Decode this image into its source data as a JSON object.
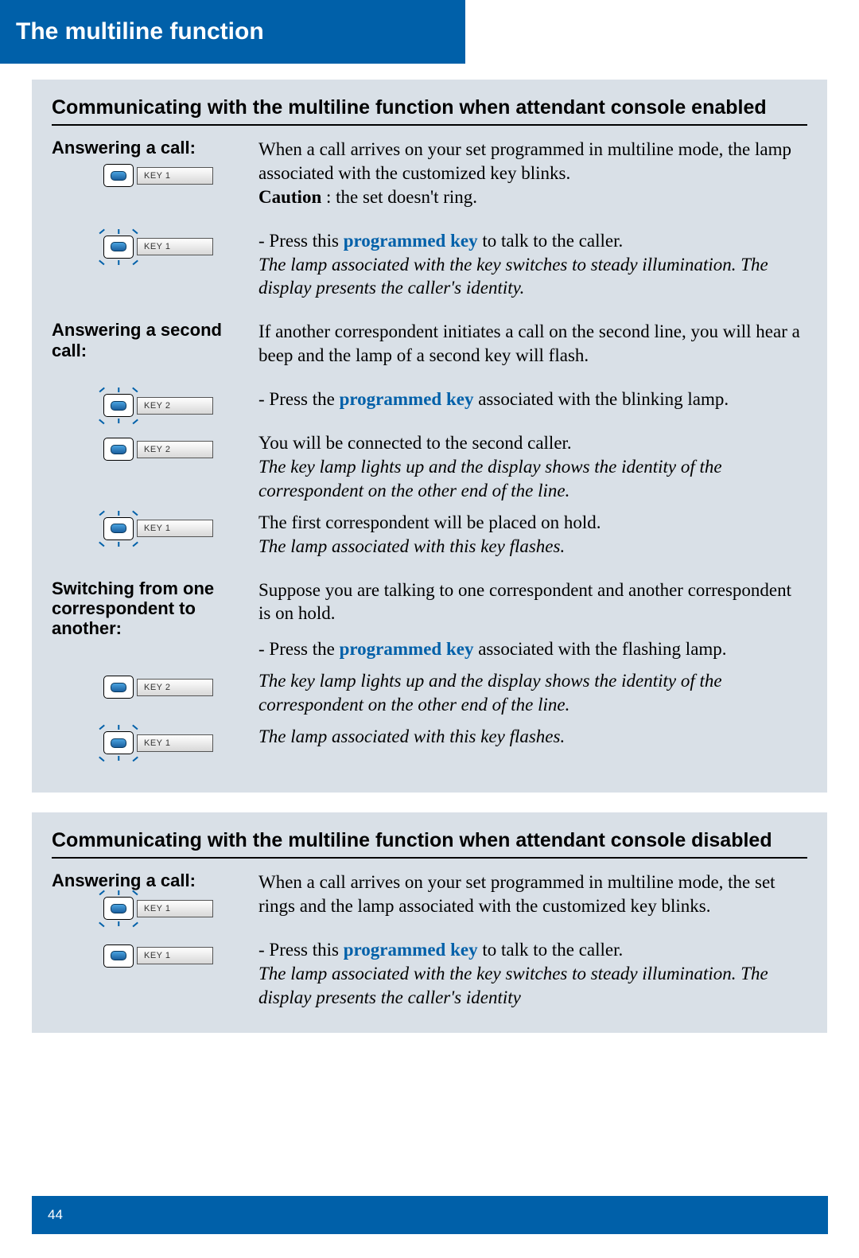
{
  "header": {
    "title": "The multiline function"
  },
  "section1": {
    "title": "Communicating with the multiline function when attendant console enabled",
    "answering": {
      "heading": "Answering a call:",
      "key1a": "KEY 1",
      "key1b": "KEY 1",
      "p1a": "When a call arrives on your set programmed in multiline mode, the lamp associated with the customized key blinks.",
      "caution_label": "Caution",
      "caution_text": " : the set doesn't ring.",
      "p2_prefix": "- Press this ",
      "p2_hl": "programmed key",
      "p2_suffix": " to talk to the caller.",
      "p2_italic": "The lamp associated with the key switches to steady illumination. The display presents the caller's identity."
    },
    "second": {
      "heading": "Answering a second call:",
      "key2a": "KEY 2",
      "key2b": "KEY 2",
      "key1c": "KEY 1",
      "p1": "If another correspondent initiates a call on the second line, you will hear a beep and the lamp of a second key will flash.",
      "p2_prefix": "- Press the ",
      "p2_hl": "programmed key",
      "p2_suffix": " associated with the blinking lamp.",
      "p3": "You will be connected to the second caller.",
      "p3_italic": "The key lamp lights up and the display shows the identity of the correspondent on the other end of the line.",
      "p4": "The first correspondent will be placed on hold.",
      "p4_italic": "The lamp associated with this key flashes."
    },
    "switch": {
      "heading": "Switching from one correspondent to another:",
      "key2c": "KEY 2",
      "key1d": "KEY 1",
      "p1": "Suppose you are talking to one correspondent and another correspondent is on hold.",
      "p2_prefix": "- Press the ",
      "p2_hl": "programmed key",
      "p2_suffix": " associated with the flashing lamp.",
      "p3_italic": "The key lamp lights up and the display shows the identity of the correspondent on the other end of the line.",
      "p4_italic": "The lamp associated with this key flashes."
    }
  },
  "section2": {
    "title": "Communicating with the multiline function when attendant console disabled",
    "answering": {
      "heading": "Answering a call:",
      "key1e": "KEY 1",
      "key1f": "KEY 1",
      "p1": "When a call arrives on your set programmed in multiline mode, the set rings and the lamp associated with the customized key blinks.",
      "p2_prefix": "- Press this ",
      "p2_hl": "programmed key",
      "p2_suffix": " to talk to the caller.",
      "p2_italic": "The lamp associated with the key switches to steady illumination. The display presents the caller's identity"
    }
  },
  "footer": {
    "page": "44"
  }
}
